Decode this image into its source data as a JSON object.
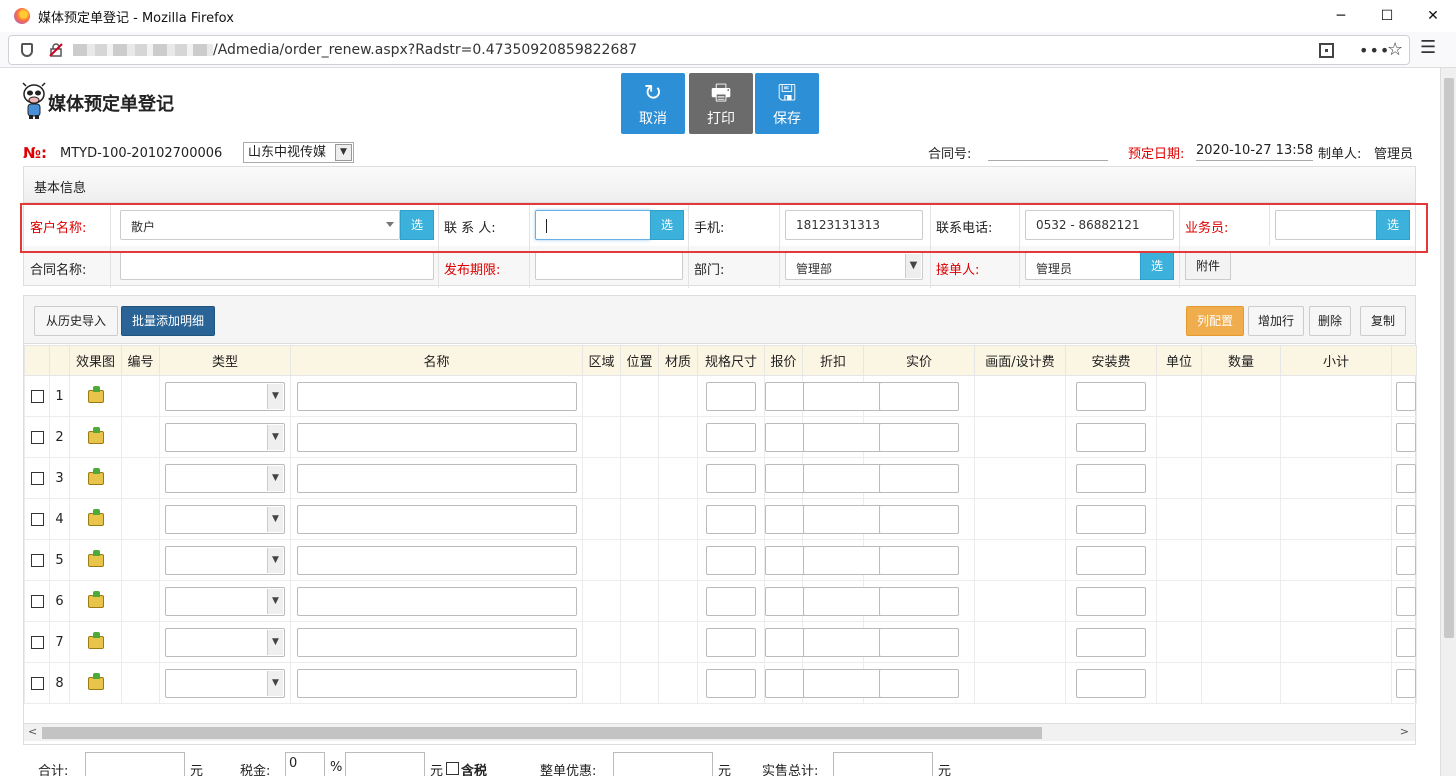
{
  "window": {
    "title": "媒体预定单登记 - Mozilla Firefox",
    "minimize": "─",
    "maximize": "☐",
    "close": "✕"
  },
  "browser": {
    "url": "/Admedia/order_renew.aspx?Radstr=0.47350920859822687",
    "more": "•••",
    "star": "☆",
    "menu": "☰"
  },
  "page": {
    "title": "媒体预定单登记",
    "buttons": {
      "cancel": "取消",
      "print": "打印",
      "save": "保存",
      "cancel_icon": "↻",
      "print_icon": "🖶",
      "save_icon": "🖫"
    },
    "order_no_label": "№:",
    "order_no": "MTYD-100-20102700006",
    "company": "山东中视传媒",
    "contract_no_label": "合同号:",
    "booking_date_label": "预定日期:",
    "booking_date": "2020-10-27 13:58",
    "maker_label": "制单人:",
    "maker": "管理员"
  },
  "basic_info": {
    "heading": "基本信息",
    "customer_label": "客户名称:",
    "customer_value": "散户",
    "contact_label": "联 系 人:",
    "contact_value": "",
    "mobile_label": "手机:",
    "mobile_value": "18123131313",
    "phone_label": "联系电话:",
    "phone_value": "0532 - 86882121",
    "salesman_label": "业务员:",
    "salesman_value": "",
    "contract_name_label": "合同名称:",
    "contract_name_value": "",
    "publish_period_label": "发布期限:",
    "publish_period_value": "",
    "department_label": "部门:",
    "department_value": "管理部",
    "receiver_label": "接单人:",
    "receiver_value": "管理员",
    "select_btn": "选",
    "attachment_btn": "附件"
  },
  "detail": {
    "toolbar": {
      "import_history": "从历史导入",
      "batch_add": "批量添加明细",
      "column_config": "列配置",
      "add_row": "增加行",
      "delete": "删除",
      "copy": "复制"
    },
    "columns": [
      "效果图",
      "编号",
      "类型",
      "名称",
      "区域",
      "位置",
      "材质",
      "规格尺寸",
      "报价",
      "折扣",
      "实价",
      "画面/设计费",
      "安装费",
      "单位",
      "数量",
      "小计"
    ],
    "rows": [
      "1",
      "2",
      "3",
      "4",
      "5",
      "6",
      "7",
      "8"
    ],
    "scroll_left": "<",
    "scroll_right": ">"
  },
  "summary": {
    "total_label": "合计:",
    "yuan": "元",
    "tax_label": "税金:",
    "tax_value": "0",
    "percent": "%",
    "tax_included": "含税",
    "discount_label": "整单优惠:",
    "grand_total_label": "实售总计:"
  },
  "colors": {
    "primary_blue": "#2d8fd5",
    "print_gray": "#6b6b6b",
    "select_blue": "#3cb1dc",
    "required_red": "#dd0000",
    "highlight_red": "#e23a3a",
    "orange": "#f0ad4e",
    "dark_blue": "#2a6496"
  }
}
